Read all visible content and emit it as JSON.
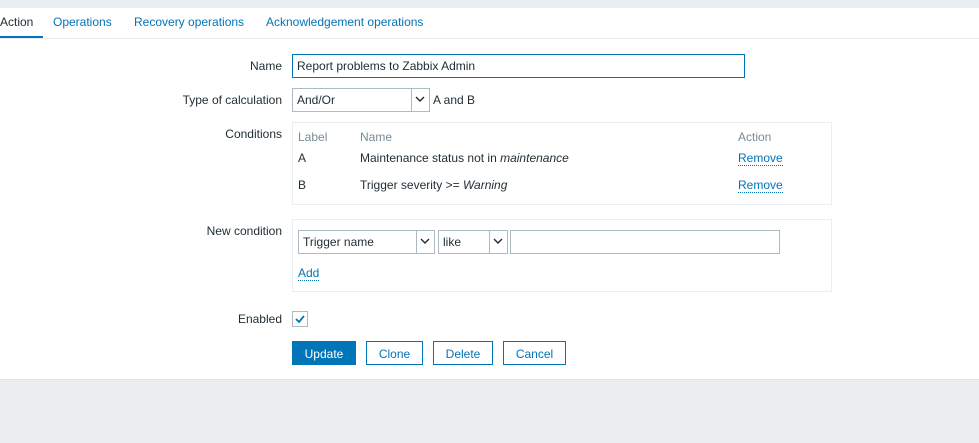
{
  "tabs": [
    {
      "label": "Action",
      "active": true
    },
    {
      "label": "Operations"
    },
    {
      "label": "Recovery operations"
    },
    {
      "label": "Acknowledgement operations"
    }
  ],
  "form": {
    "name_label": "Name",
    "name_value": "Report problems to Zabbix Admin",
    "calc_label": "Type of calculation",
    "calc_value": "And/Or",
    "calc_formula": "A and B",
    "conditions_label": "Conditions",
    "conditions_headers": {
      "label": "Label",
      "name": "Name",
      "action": "Action"
    },
    "conditions": [
      {
        "label": "A",
        "name_prefix": "Maintenance status not in ",
        "name_emphasis": "maintenance",
        "action": "Remove"
      },
      {
        "label": "B",
        "name_prefix": "Trigger severity >= ",
        "name_emphasis": "Warning",
        "action": "Remove"
      }
    ],
    "new_condition_label": "New condition",
    "new_condition_type": "Trigger name",
    "new_condition_operator": "like",
    "new_condition_value": "",
    "add_label": "Add",
    "enabled_label": "Enabled",
    "enabled": true
  },
  "buttons": {
    "update": "Update",
    "clone": "Clone",
    "delete": "Delete",
    "cancel": "Cancel"
  },
  "colors": {
    "accent": "#0275b8",
    "background": "#ebeef0",
    "text": "#1f2c33",
    "muted": "#768d99"
  }
}
